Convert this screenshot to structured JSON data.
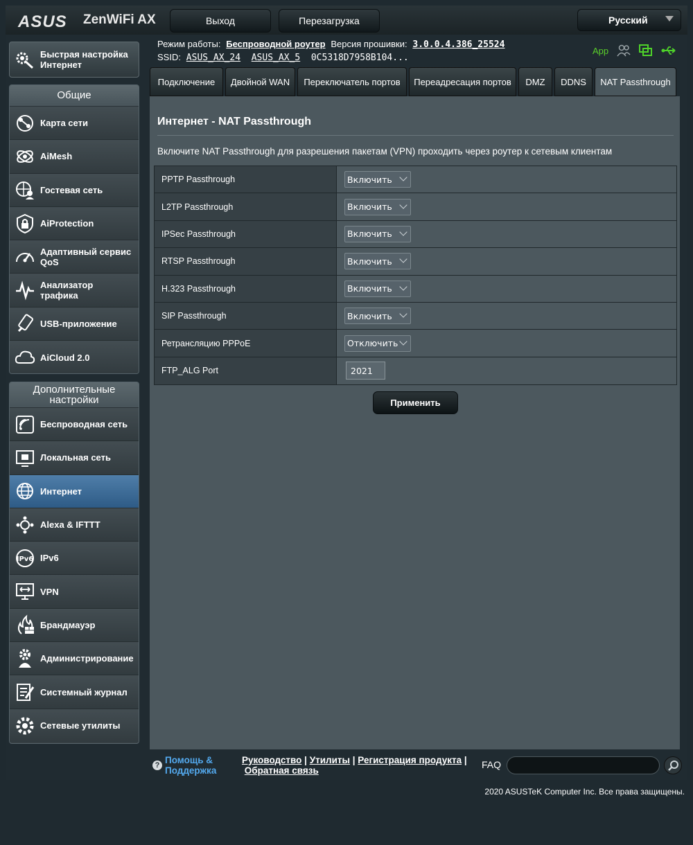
{
  "header": {
    "brand": "ASUS",
    "model": "ZenWiFi AX",
    "logout_label": "Выход",
    "reboot_label": "Перезагрузка",
    "language": "Русский"
  },
  "status": {
    "mode_label": "Режим работы:",
    "mode_value": "Беспроводной роутер",
    "firmware_label": "Версия прошивки:",
    "firmware_value": "3.0.0.4.386_25524",
    "ssid_label": "SSID:",
    "ssid1": "ASUS_AX_24",
    "ssid2": "ASUS_AX_5",
    "ssid3": "0C5318D7958B104...",
    "app_label": "App"
  },
  "sidebar": {
    "quick_setup": "Быстрая настройка Интернет",
    "general_header": "Общие",
    "general_items": [
      {
        "label": "Карта сети",
        "icon": "network-map-icon"
      },
      {
        "label": "AiMesh",
        "icon": "aimesh-icon"
      },
      {
        "label": "Гостевая сеть",
        "icon": "guest-network-icon"
      },
      {
        "label": "AiProtection",
        "icon": "shield-lock-icon"
      },
      {
        "label": "Адаптивный сервис QoS",
        "icon": "speedometer-icon"
      },
      {
        "label": "Анализатор трафика",
        "icon": "traffic-analyzer-icon"
      },
      {
        "label": "USB-приложение",
        "icon": "usb-icon"
      },
      {
        "label": "AiCloud 2.0",
        "icon": "cloud-icon"
      }
    ],
    "advanced_header": "Дополнительные настройки",
    "advanced_items": [
      {
        "label": "Беспроводная сеть",
        "icon": "wireless-icon"
      },
      {
        "label": "Локальная сеть",
        "icon": "lan-icon"
      },
      {
        "label": "Интернет",
        "icon": "globe-icon"
      },
      {
        "label": "Alexa & IFTTT",
        "icon": "alexa-icon"
      },
      {
        "label": "IPv6",
        "icon": "ipv6-icon"
      },
      {
        "label": "VPN",
        "icon": "vpn-icon"
      },
      {
        "label": "Брандмауэр",
        "icon": "firewall-icon"
      },
      {
        "label": "Администрирование",
        "icon": "admin-gear-icon"
      },
      {
        "label": "Системный журнал",
        "icon": "log-icon"
      },
      {
        "label": "Сетевые утилиты",
        "icon": "tools-gear-icon"
      }
    ]
  },
  "tabs": [
    {
      "label": "Подключение"
    },
    {
      "label": "Двойной WAN"
    },
    {
      "label": "Переключатель портов"
    },
    {
      "label": "Переадресация портов"
    },
    {
      "label": "DMZ"
    },
    {
      "label": "DDNS"
    },
    {
      "label": "NAT Passthrough"
    }
  ],
  "main": {
    "title": "Интернет - NAT Passthrough",
    "description": "Включите NAT Passthrough для разрешения пакетам (VPN) проходить через роутер к сетевым клиентам",
    "rows": [
      {
        "label": "PPTP Passthrough",
        "value": "Включить"
      },
      {
        "label": "L2TP Passthrough",
        "value": "Включить"
      },
      {
        "label": "IPSec Passthrough",
        "value": "Включить"
      },
      {
        "label": "RTSP Passthrough",
        "value": "Включить"
      },
      {
        "label": "H.323 Passthrough",
        "value": "Включить"
      },
      {
        "label": "SIP Passthrough",
        "value": "Включить"
      },
      {
        "label": "Ретрансляцию PPPoE",
        "value": "Отключить"
      }
    ],
    "ftp_label": "FTP_ALG Port",
    "ftp_value": "2021",
    "apply_label": "Применить"
  },
  "footer": {
    "help_line1": "Помощь &",
    "help_line2": "Поддержка",
    "link_manual": "Руководство",
    "link_utils": "Утилиты",
    "link_register": "Регистрация продукта",
    "link_feedback": "Обратная связь",
    "faq_label": "FAQ",
    "copyright": "2020 ASUSTeK Computer Inc. Все права защищены."
  }
}
